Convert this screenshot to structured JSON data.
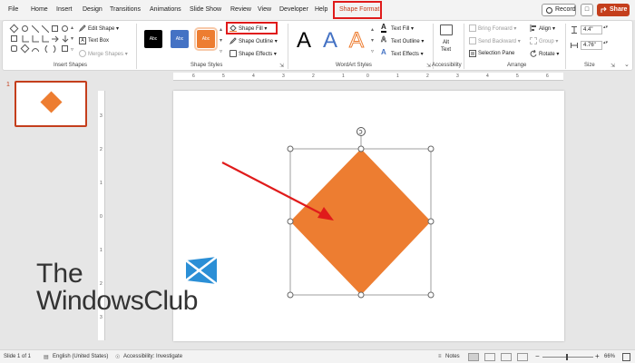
{
  "menu": {
    "tabs": [
      "File",
      "Home",
      "Insert",
      "Design",
      "Transitions",
      "Animations",
      "Slide Show",
      "Review",
      "View",
      "Developer",
      "Help",
      "Shape Format"
    ],
    "active_tab": "Shape Format",
    "record_label": "Record",
    "share_label": "Share"
  },
  "ribbon": {
    "insert_shapes": {
      "edit_shape": "Edit Shape",
      "text_box": "Text Box",
      "merge_shapes": "Merge Shapes",
      "label": "Insert Shapes"
    },
    "shape_styles": {
      "samples": [
        "Abc",
        "Abc",
        "Abc"
      ],
      "shape_fill": "Shape Fill",
      "shape_outline": "Shape Outline",
      "shape_effects": "Shape Effects",
      "label": "Shape Styles"
    },
    "wordart": {
      "letters": [
        "A",
        "A",
        "A"
      ],
      "text_fill": "Text Fill",
      "text_outline": "Text Outline",
      "text_effects": "Text Effects",
      "label": "WordArt Styles"
    },
    "accessibility": {
      "alt_text_line1": "Alt",
      "alt_text_line2": "Text",
      "label": "Accessibility"
    },
    "arrange": {
      "bring_forward": "Bring Forward",
      "send_backward": "Send Backward",
      "selection_pane": "Selection Pane",
      "align": "Align",
      "group": "Group",
      "rotate": "Rotate",
      "label": "Arrange"
    },
    "size": {
      "height": "4.4\"",
      "width": "4.76\"",
      "label": "Size"
    }
  },
  "slides_panel": {
    "slide_number": "1"
  },
  "ruler": {
    "h_ticks": [
      "6",
      "5",
      "4",
      "3",
      "2",
      "1",
      "0",
      "1",
      "2",
      "3",
      "4",
      "5",
      "6"
    ],
    "v_ticks": [
      "3",
      "2",
      "1",
      "0",
      "1",
      "2",
      "3"
    ]
  },
  "watermark": {
    "line1": "The",
    "line2": "WindowsClub"
  },
  "status": {
    "slide_info": "Slide 1 of 1",
    "language": "English (United States)",
    "accessibility": "Accessibility: Investigate",
    "notes": "Notes",
    "zoom": "66%"
  },
  "colors": {
    "accent": "#c43e1c",
    "shape_fill": "#ed7d31",
    "highlight": "#e01b1b",
    "style_black": "#000000",
    "style_blue": "#4472c4",
    "style_orange": "#ed7d31"
  }
}
